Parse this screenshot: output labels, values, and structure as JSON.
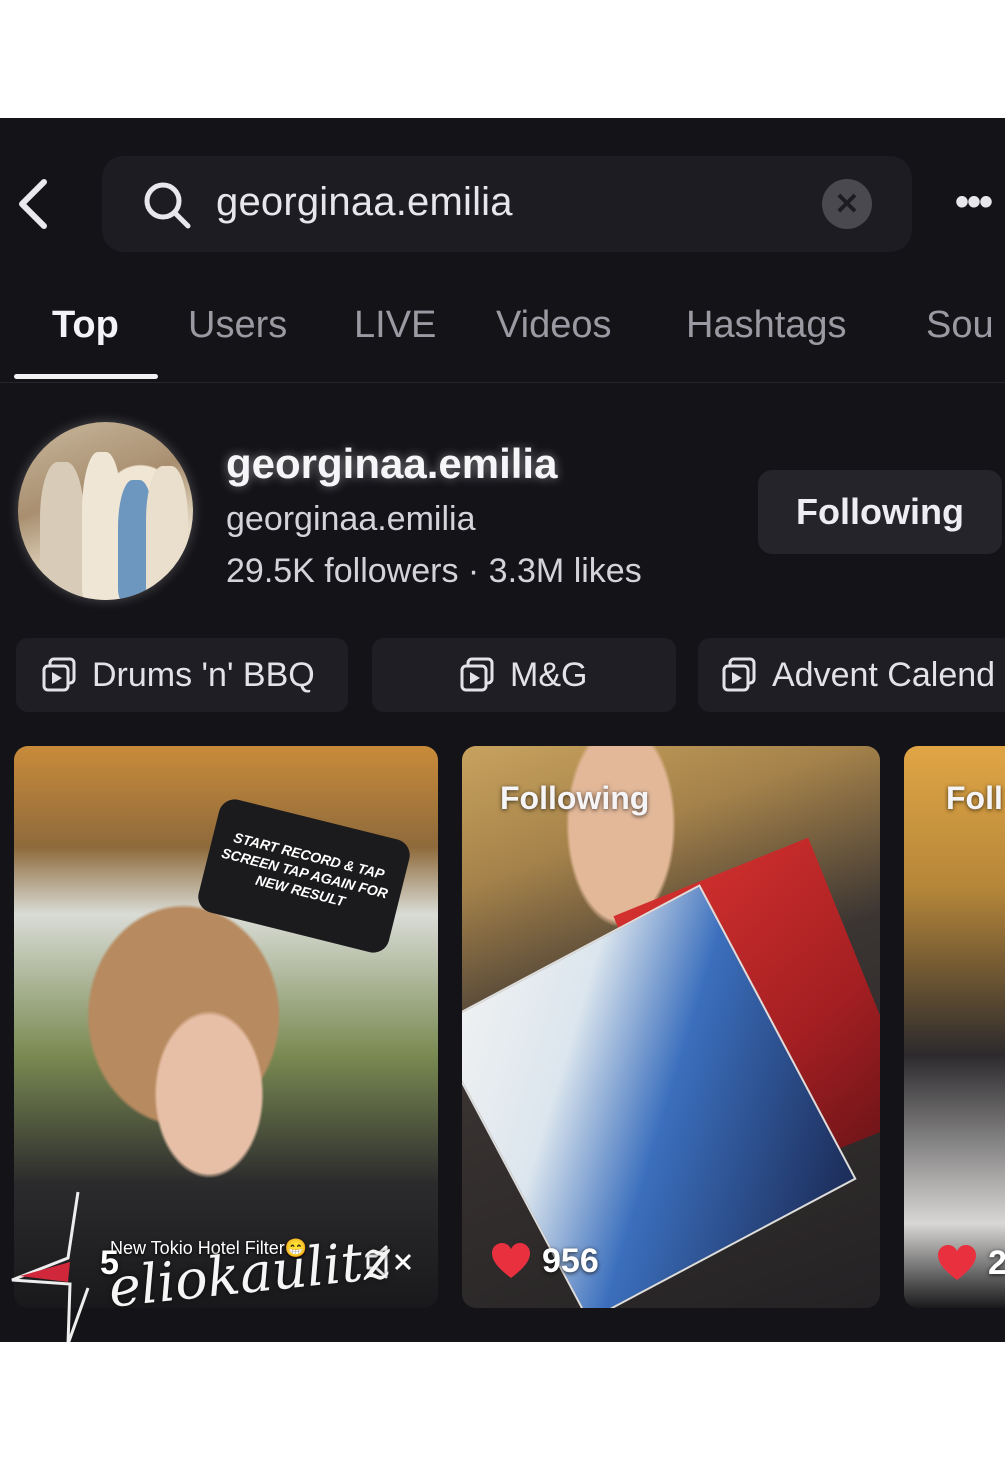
{
  "search": {
    "query": "georginaa.emilia"
  },
  "tabs": [
    {
      "label": "Top"
    },
    {
      "label": "Users"
    },
    {
      "label": "LIVE"
    },
    {
      "label": "Videos"
    },
    {
      "label": "Hashtags"
    },
    {
      "label": "Sou"
    }
  ],
  "active_tab": "Top",
  "user": {
    "display_name": "georginaa.emilia",
    "username": "georginaa.emilia",
    "stats": "29.5K followers · 3.3M likes",
    "follow_label": "Following"
  },
  "playlists": [
    {
      "label": "Drums 'n' BBQ"
    },
    {
      "label": "M&G"
    },
    {
      "label": "Advent Calend"
    }
  ],
  "videos": [
    {
      "filter_text": "START RECORD & TAP SCREEN TAP AGAIN FOR NEW RESULT",
      "caption": "New Tokio Hotel Filter😁",
      "likes": "5"
    },
    {
      "badge": "Following",
      "likes": "956"
    },
    {
      "badge": "Foll",
      "likes": "2"
    }
  ],
  "watermark": "eliokaulitz",
  "colors": {
    "accent_heart": "#e8303f",
    "background": "#141318"
  }
}
